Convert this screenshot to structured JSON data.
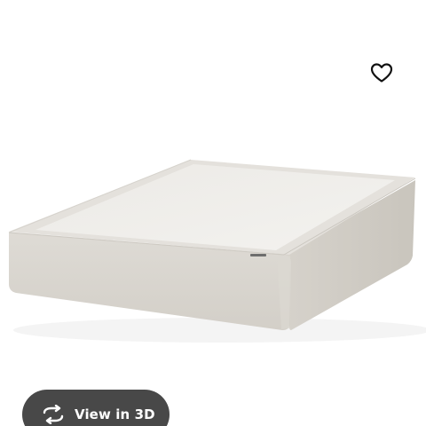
{
  "product_view": {
    "favorite": {
      "icon": "heart-outline-icon"
    },
    "image": {
      "subject": "box-spring-foundation"
    },
    "view_3d_button": {
      "icon": "rotate-3d-icon",
      "label": "View in 3D",
      "background": "#484848",
      "text_color": "#ffffff"
    }
  }
}
